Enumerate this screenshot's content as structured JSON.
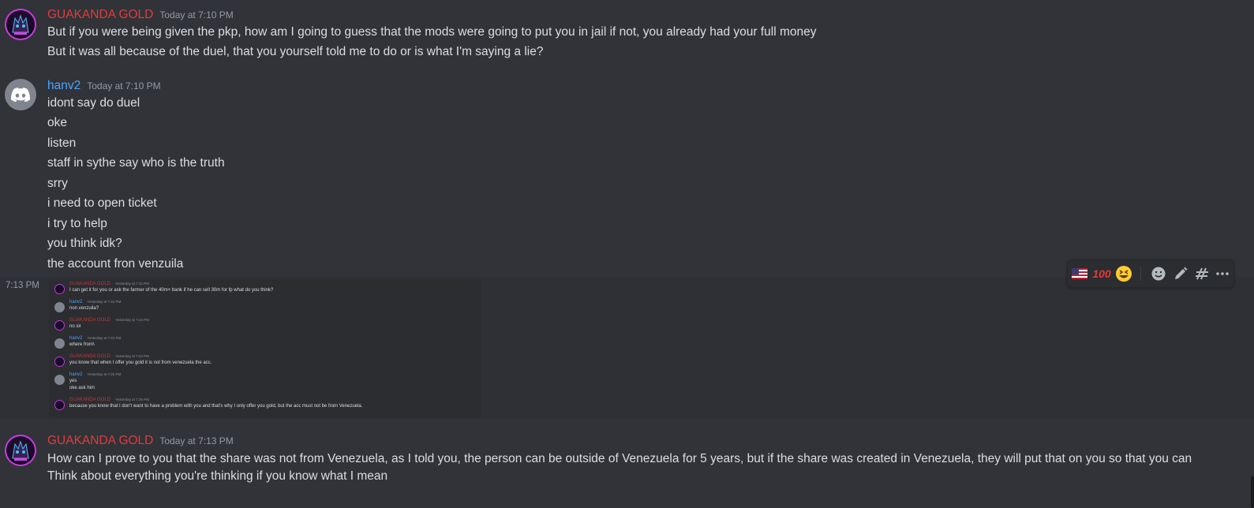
{
  "messages": [
    {
      "author": "GUAKANDA GOLD",
      "timestamp": "Today at 7:10 PM",
      "lines": [
        "But if you were being given the pkp, how am I going to guess that the mods were going to put you in jail if not, you already had your full money",
        "But it was all because of the duel, that you yourself told me to do or is what I'm saying a lie?"
      ]
    },
    {
      "author": "hanv2",
      "timestamp": "Today at 7:10 PM",
      "lines": [
        "idont say do duel",
        "oke",
        "listen",
        "staff in sythe say who is the truth",
        "srry",
        "i need to open ticket",
        "i try to help",
        "you think idk?",
        "the account fron venzuila"
      ]
    },
    {
      "author": "GUAKANDA GOLD",
      "timestamp": "Today at 7:13 PM",
      "lines": [
        "How can I prove to you that the share was not from Venezuela, as I told you, the person can be outside of Venezuela for 5 years, but if the share was created in Venezuela, they will put that on you so that you can Think about everything you're thinking if you know what I mean"
      ]
    }
  ],
  "attachment": {
    "side_timestamp": "7:13 PM",
    "entries": [
      {
        "author": "GUAKANDA GOLD",
        "timestamp": "Yesterday at 7:22 PM",
        "lines": [
          "I can get it for you or ask the farmer of the 40m+ bank if he can sell 30m for fp what do you think?"
        ]
      },
      {
        "author": "hanv2",
        "timestamp": "Yesterday at 7:24 PM",
        "lines": [
          "non venzuila?"
        ]
      },
      {
        "author": "GUAKANDA GOLD",
        "timestamp": "Yesterday at 7:24 PM",
        "lines": [
          "no sir"
        ]
      },
      {
        "author": "hanv2",
        "timestamp": "Yesterday at 7:24 PM",
        "lines": [
          "where from\\"
        ]
      },
      {
        "author": "GUAKANDA GOLD",
        "timestamp": "Yesterday at 7:24 PM",
        "lines": [
          "you know that when I offer you gold it is not from venezuela the acc."
        ]
      },
      {
        "author": "hanv2",
        "timestamp": "Yesterday at 7:25 PM",
        "lines": [
          "yes",
          "oke ask him"
        ]
      },
      {
        "author": "GUAKANDA GOLD",
        "timestamp": "Yesterday at 7:25 PM",
        "lines": [
          "because you know that I don't want to have a problem with you and that's why I only offer you gold, but the acc must not be from Venezuela."
        ]
      }
    ]
  },
  "toolbar": {
    "reactions": [
      "us-flag-emoji",
      "hundred-points-emoji",
      "grinning-squinting-emoji"
    ],
    "actions": [
      "add-reaction",
      "edit",
      "create-thread",
      "more"
    ]
  },
  "colors": {
    "background": "#313338",
    "red_username": "#e03c3c",
    "blue_username": "#4ca4ff",
    "timestamp": "#949ba4",
    "text": "#dbdee1"
  }
}
